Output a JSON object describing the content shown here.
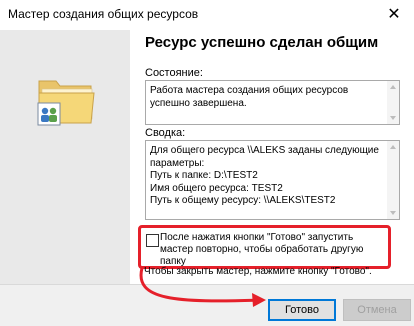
{
  "window": {
    "title": "Мастер создания общих ресурсов",
    "close_glyph": "✕"
  },
  "main": {
    "heading": "Ресурс успешно сделан общим",
    "status_label": "Состояние:",
    "status_text": "Работа мастера создания общих ресурсов успешно завершена.",
    "summary_label": "Сводка:",
    "summary_text": "Для общего ресурса \\\\ALEKS заданы следующие параметры:\nПуть к папке: D:\\TEST2\nИмя общего ресурса: TEST2\nПуть к общему ресурсу: \\\\ALEKS\\TEST2",
    "checkbox_label": "После нажатия кнопки \"Готово\" запустить мастер повторно, чтобы обработать другую папку",
    "checkbox_checked": false,
    "footer_text": "Чтобы закрыть мастер, нажмите кнопку \"Готово\"."
  },
  "buttons": {
    "finish": "Готово",
    "cancel": "Отмена"
  },
  "icons": {
    "side_icon": "shared-folder-icon"
  },
  "colors": {
    "highlight": "#e5202a",
    "accent": "#0078d7"
  }
}
